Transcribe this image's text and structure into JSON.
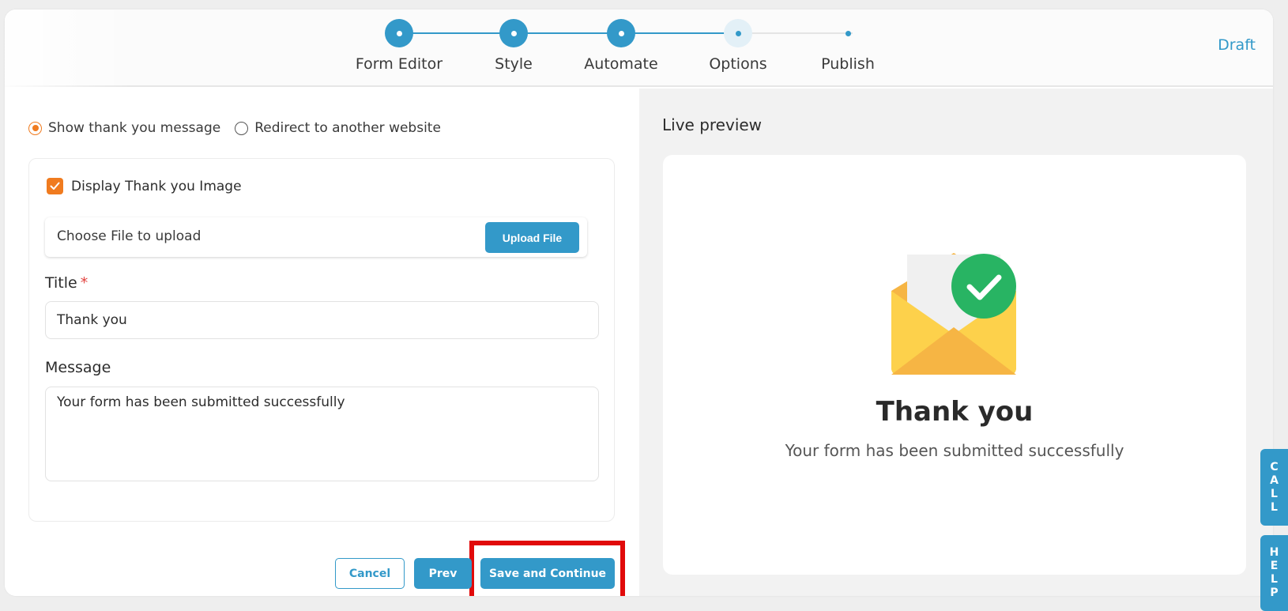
{
  "stepper": {
    "steps": [
      {
        "label": "Form Editor",
        "state": "done"
      },
      {
        "label": "Style",
        "state": "done"
      },
      {
        "label": "Automate",
        "state": "done"
      },
      {
        "label": "Options",
        "state": "current"
      },
      {
        "label": "Publish",
        "state": "todo"
      }
    ],
    "status": "Draft"
  },
  "options": {
    "radio_thank_you": "Show thank you message",
    "radio_redirect": "Redirect to another website",
    "selected": "thank_you",
    "display_image_label": "Display Thank you Image",
    "display_image_checked": true,
    "upload_text": "Choose File to upload",
    "upload_button": "Upload File",
    "title_label": "Title",
    "title_required_mark": "*",
    "title_value": "Thank you",
    "message_label": "Message",
    "message_value": "Your form has been submitted successfully"
  },
  "footer": {
    "cancel": "Cancel",
    "prev": "Prev",
    "save": "Save and Continue"
  },
  "preview": {
    "heading": "Live preview",
    "title": "Thank you",
    "message": "Your form has been submitted successfully"
  },
  "side_tabs": {
    "call": [
      "C",
      "A",
      "L",
      "L"
    ],
    "help": [
      "H",
      "E",
      "L",
      "P"
    ]
  },
  "colors": {
    "accent": "#3399c9",
    "orange": "#f07b1f",
    "highlight": "#e10a0a",
    "success": "#28b463",
    "envelope": "#fdd14b"
  }
}
